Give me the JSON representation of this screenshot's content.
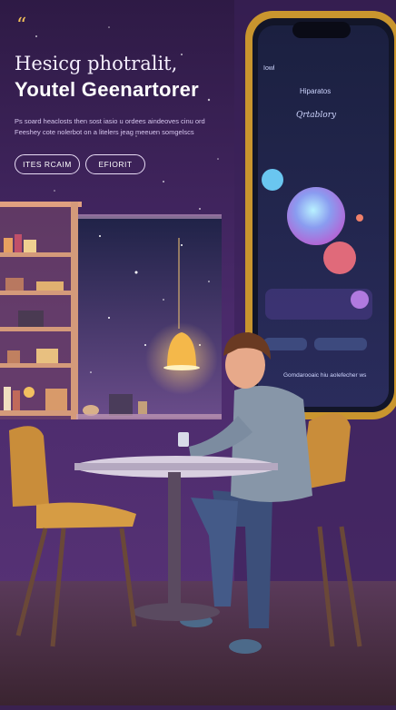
{
  "hero": {
    "quote_mark": "“",
    "title_line1": "Hesicg photralit,",
    "title_line2": "Youtel Geenartorer",
    "paragraph": "Ps soard heaclosts then sost iasio u ordees aindeoves cinu ord Feeshey cote nolerbot on a litelers jeag meeuen somgelscs",
    "button_primary": "ITES RCAIM",
    "button_secondary": "EFIORIT"
  },
  "phone": {
    "status_left": "Iowl",
    "header_title": "Hiparatos",
    "card_title": "Qrtablory",
    "bottom_text": "Gomdarooaic hiu aolefecher ws",
    "accent": "#b07ae0"
  },
  "colors": {
    "wall": "#3a2150",
    "lamp": "#f4b84a",
    "phone_frame": "#c9952e"
  }
}
